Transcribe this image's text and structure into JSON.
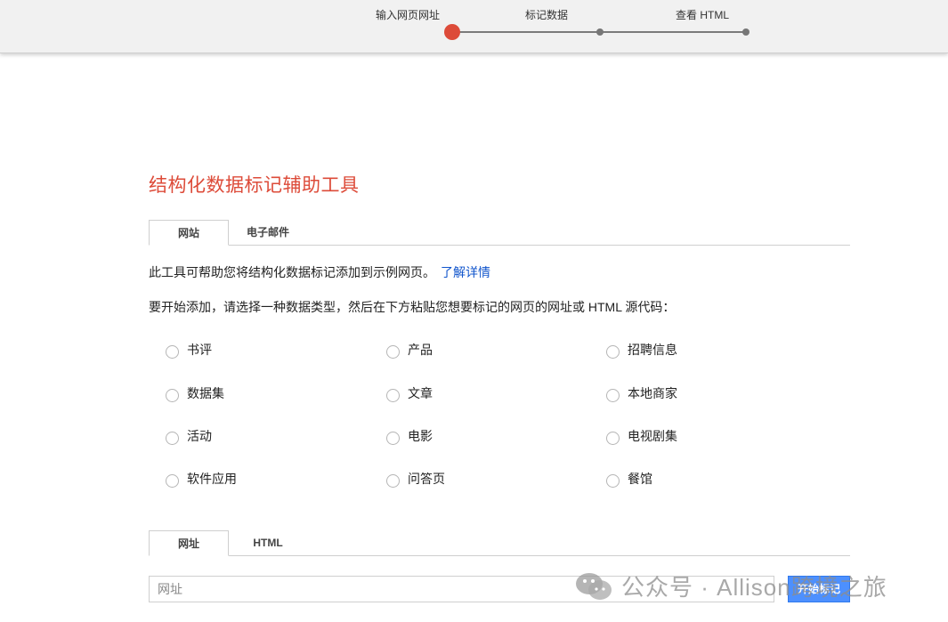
{
  "progress": {
    "steps": [
      "输入网页网址",
      "标记数据",
      "查看 HTML"
    ],
    "active_index": 0
  },
  "main": {
    "title": "结构化数据标记辅助工具",
    "source_tabs": [
      "网站",
      "电子邮件"
    ],
    "selected_source_tab": 0,
    "description": "此工具可帮助您将结构化数据标记添加到示例网页。",
    "learn_more": "了解详情",
    "instruction": "要开始添加，请选择一种数据类型，然后在下方粘贴您想要标记的网页的网址或 HTML 源代码：",
    "data_types": [
      "书评",
      "产品",
      "招聘信息",
      "数据集",
      "文章",
      "本地商家",
      "活动",
      "电影",
      "电视剧集",
      "软件应用",
      "问答页",
      "餐馆"
    ],
    "input_tabs": [
      "网址",
      "HTML"
    ],
    "selected_input_tab": 0,
    "url_placeholder": "网址",
    "start_button": "开始标记"
  },
  "watermark": {
    "text": "公众号 · Allison跨境之旅",
    "icon": "wechat-icon"
  },
  "colors": {
    "accent_red": "#dd4b39",
    "link_blue": "#1155cc",
    "button_blue": "#4d90fe"
  }
}
